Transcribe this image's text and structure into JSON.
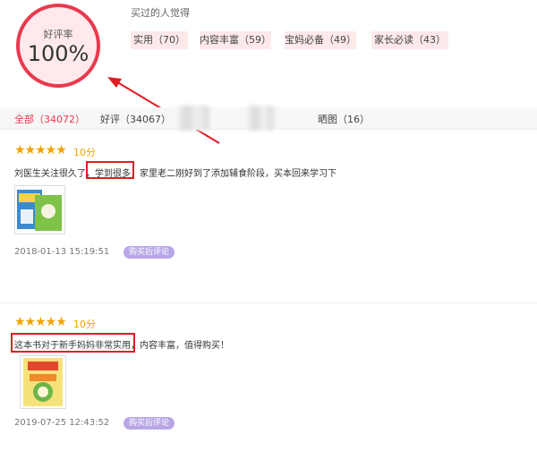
{
  "summary": {
    "rating_caption": "好评率",
    "rating_value": "100%",
    "tags_title": "买过的人觉得",
    "tags": [
      {
        "label": "实用（70）"
      },
      {
        "label": "内容丰富（59）"
      },
      {
        "label": "宝妈必备（49）"
      },
      {
        "label": "家长必读（43）"
      }
    ]
  },
  "tabs": [
    {
      "label": "全部",
      "count": "（34072）",
      "active": true
    },
    {
      "label": "好评（34067）"
    },
    {
      "label": "晒图（16）"
    }
  ],
  "reviews": [
    {
      "stars": "★★★★★",
      "score": "10分",
      "text_before": "刘医生关注很久了，",
      "highlight": "学到很多",
      "text_after": "，家里老二刚好到了添加辅食阶段，买本回来学习下",
      "date": "2018-01-13 15:19:51",
      "badge": "购买后评论"
    },
    {
      "stars": "★★★★★",
      "score": "10分",
      "highlight": "这本书对于新手妈妈非常实用，",
      "text_after": "内容丰富，值得购买！",
      "date": "2019-07-25 12:43:52",
      "badge": "购买后评论"
    }
  ],
  "colors": {
    "accent": "#e9394d",
    "star": "#f0a300",
    "badge": "#b9a6e6",
    "annotation": "#e31b23"
  }
}
